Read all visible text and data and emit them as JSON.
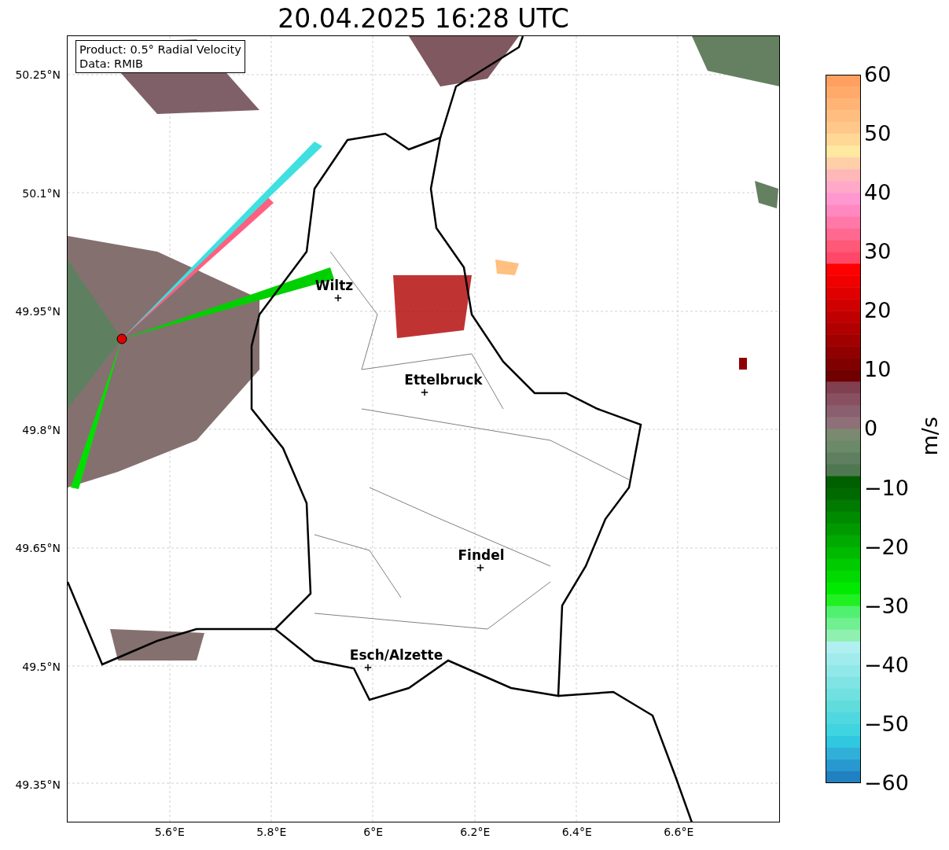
{
  "title": "20.04.2025 16:28 UTC",
  "info_box": {
    "lines": [
      "Product: 0.5° Radial Velocity",
      "Data: RMIB"
    ]
  },
  "map": {
    "cities": [
      {
        "name": "Wiltz"
      },
      {
        "name": "Ettelbruck"
      },
      {
        "name": "Findel"
      },
      {
        "name": "Esch/Alzette"
      }
    ],
    "y_ticks": [
      "50.25°N",
      "50.1°N",
      "49.95°N",
      "49.8°N",
      "49.65°N",
      "49.5°N",
      "49.35°N"
    ],
    "x_ticks": [
      "5.6°E",
      "5.8°E",
      "6°E",
      "6.2°E",
      "6.4°E",
      "6.6°E"
    ]
  },
  "colorbar": {
    "label": "m/s",
    "ticks": [
      "60",
      "50",
      "40",
      "30",
      "20",
      "10",
      "0",
      "−10",
      "−20",
      "−30",
      "−40",
      "−50",
      "−60"
    ]
  }
}
